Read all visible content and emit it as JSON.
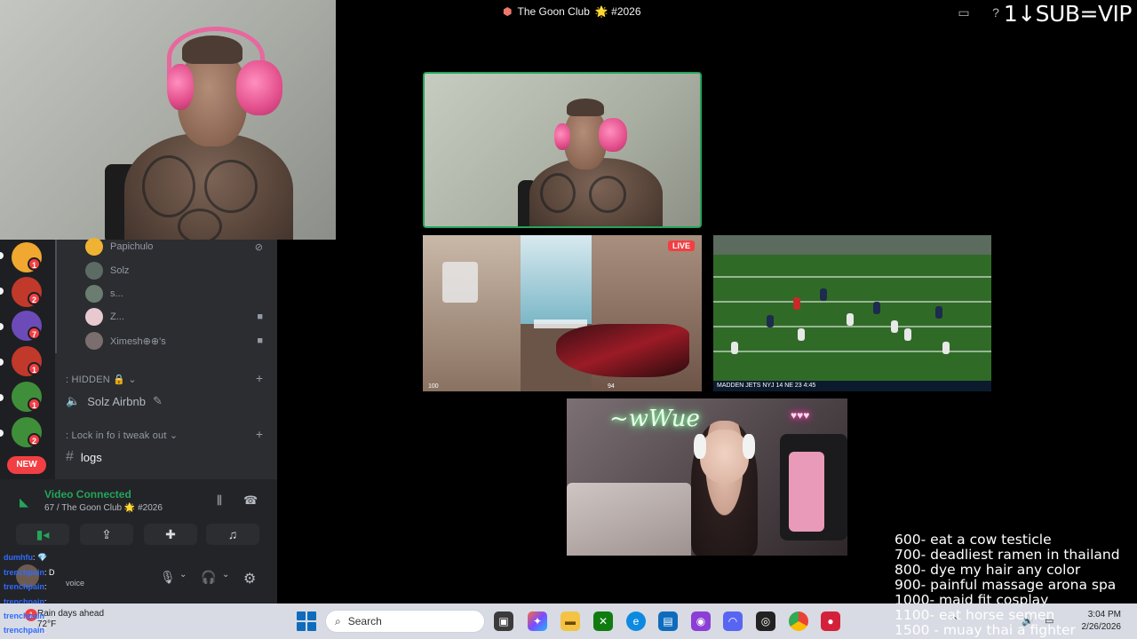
{
  "titlebar": {
    "server_name": "The Goon Club",
    "channel_suffix": "🌟 #2026",
    "sub_text": "1↓SUB=VIP"
  },
  "servers": [
    {
      "badge": "1",
      "color": "#f0a830"
    },
    {
      "badge": "2",
      "color": "#c0392b"
    },
    {
      "badge": "7",
      "color": "#6c4bb8"
    },
    {
      "badge": "1",
      "color": "#c0392b"
    },
    {
      "badge": "1",
      "color": "#3f8f3a"
    },
    {
      "badge": "2",
      "color": "#3f8f3a"
    }
  ],
  "new_badge": "NEW",
  "voice_users": [
    {
      "name": "Papichulo",
      "color": "#f0b232"
    },
    {
      "name": "Solz",
      "color": "#5c6b63"
    },
    {
      "name": "s...",
      "color": "#6b7d70"
    },
    {
      "name": "Z...",
      "color": "#e8c9d0"
    },
    {
      "name": "Ximesh⊕⊕'s",
      "color": "#7a6e6e"
    }
  ],
  "categories": {
    "hidden": ": HIDDEN 🔒",
    "lock_in": ": Lock in fo i tweak out"
  },
  "channels": {
    "voice_channel": "Solz Airbnb",
    "text_channel": "logs"
  },
  "voice_panel": {
    "status": "Video Connected",
    "detail": "67 / The Goon Club 🌟 #2026"
  },
  "user_panel": {
    "status": "voice"
  },
  "chat_overlay": [
    {
      "user": "dumhfu",
      "msg": ": 💎"
    },
    {
      "user": "trenchpain",
      "msg": ": D"
    },
    {
      "user": "trenchpain",
      "msg": ": "
    },
    {
      "user": "trenchpain",
      "msg": ": "
    },
    {
      "user": "trenchpain",
      "msg": ": "
    },
    {
      "user": "trenchpain",
      "msg": ": "
    }
  ],
  "streams": {
    "live_label": "LIVE",
    "game_hud_left": "100",
    "game_hud_right": "94",
    "football_scorebug": "MADDEN  JETS  NYJ  14  NE  23  4:45",
    "neon_sign": "~wWue",
    "neon_pink": "♥♥♥"
  },
  "sub_goals": [
    "600- eat a cow testicle",
    "700- deadliest ramen in thailand",
    "800- dye my hair any color",
    "900- painful massage arona spa",
    "1000- maid fit cosplay",
    "1100- eat horse semen",
    "1500 - muay thai a fighter"
  ],
  "taskbar": {
    "weather_temp": "72°F",
    "weather_text": "Rain days ahead",
    "weather_badge": "1",
    "search_placeholder": "Search",
    "time": "3:04 PM",
    "date": "2/26/2026"
  }
}
